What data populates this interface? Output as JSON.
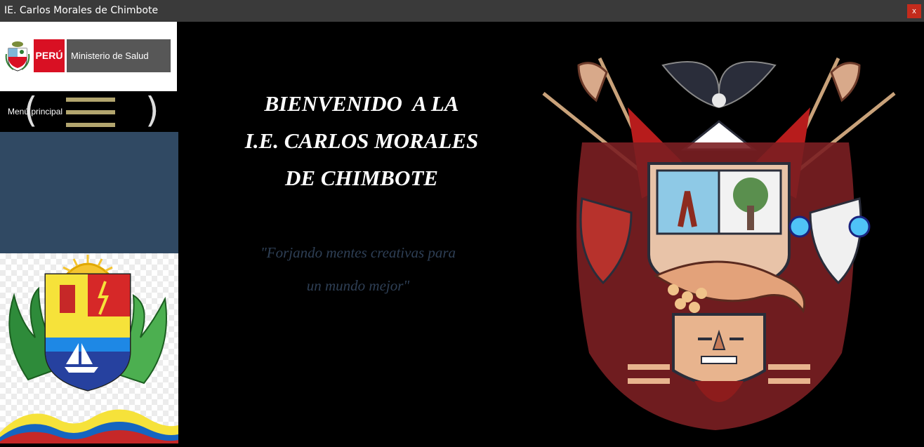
{
  "window": {
    "title": "IE. Carlos Morales de Chimbote",
    "close_label": "x"
  },
  "header_logo": {
    "country": "PERÚ",
    "ministry": "Ministerio de Salud"
  },
  "menu": {
    "label": "Menú principal"
  },
  "main": {
    "welcome_lines": [
      "BIENVENIDO  A LA",
      "I.E. CARLOS MORALES",
      "DE CHIMBOTE"
    ],
    "motto_lines": [
      "\"Forjando mentes creativas para",
      "un mundo mejor\""
    ]
  },
  "colors": {
    "peru_red": "#d91023",
    "navy_panel": "#304963",
    "menu_gold": "#b2a56e",
    "motto_color": "#2e3f55"
  }
}
